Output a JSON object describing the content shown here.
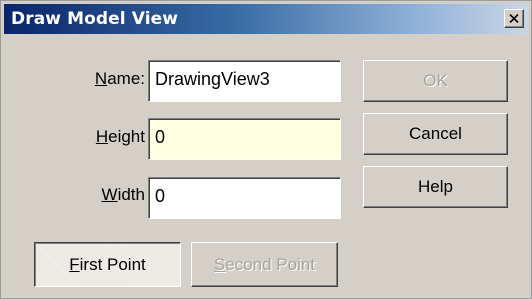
{
  "window": {
    "title": "Draw Model View",
    "close_glyph": "×"
  },
  "form": {
    "name": {
      "mnemonic": "N",
      "rest": "ame:",
      "value": "DrawingView3"
    },
    "height": {
      "mnemonic": "H",
      "rest": "eight",
      "value": "0"
    },
    "width": {
      "mnemonic": "W",
      "rest": "idth",
      "value": "0"
    }
  },
  "buttons": {
    "ok": {
      "label": "OK",
      "enabled": false
    },
    "cancel": {
      "label": "Cancel"
    },
    "help": {
      "label": "Help"
    },
    "first_point": {
      "mnemonic": "F",
      "rest": "irst Point",
      "pressed": true
    },
    "second_point": {
      "mnemonic": "S",
      "rest": "econd Point",
      "enabled": false
    }
  },
  "colors": {
    "title_gradient_start": "#0a246a",
    "title_gradient_end": "#c9d6e6",
    "focused_field_bg": "#ffffe1",
    "dialog_bg": "#d4d0c8"
  }
}
